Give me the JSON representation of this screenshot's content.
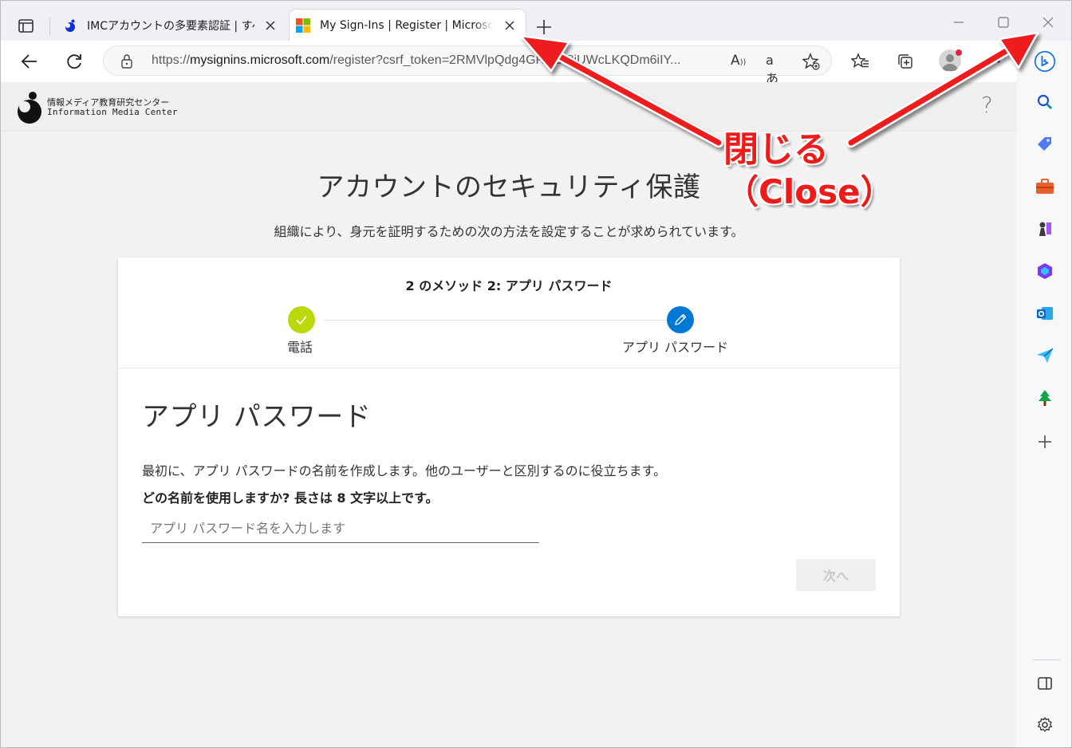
{
  "browser": {
    "tabs": [
      {
        "title": "IMCアカウントの多要素認証 | すべて",
        "active": false
      },
      {
        "title": "My Sign-Ins | Register | Microsoft",
        "active": true
      }
    ],
    "url_prefix": "https://",
    "url_host": "mysignins.microsoft.com",
    "url_rest": "/register?csrf_token=2RMVlpQdg4GRBOI8jUWcLKQDm6iIY...",
    "read_aloud_label": "A",
    "translate_label": "aあ"
  },
  "org": {
    "name_ja": "情報メディア教育研究センター",
    "name_en": "Information Media Center",
    "help_label": "?"
  },
  "page": {
    "title": "アカウントのセキュリティ保護",
    "subtitle": "組織により、身元を証明するための次の方法を設定することが求められています。"
  },
  "wizard": {
    "step_title": "2 のメソッド 2: アプリ パスワード",
    "steps": [
      {
        "label": "電話",
        "status": "done"
      },
      {
        "label": "アプリ パスワード",
        "status": "current"
      }
    ],
    "section_title": "アプリ パスワード",
    "description": "最初に、アプリ パスワードの名前を作成します。他のユーザーと区別するのに役立ちます。",
    "question": "どの名前を使用しますか? 長さは 8 文字以上です。",
    "input_placeholder": "アプリ パスワード名を入力します",
    "input_value": "",
    "next_label": "次へ",
    "next_enabled": false
  },
  "annotation": {
    "label_ja": "閉じる",
    "label_en": "（Close）",
    "color": "#ee1b1b"
  },
  "colors": {
    "step_done": "#bad80a",
    "step_current": "#0078d4",
    "accent": "#0078d4"
  }
}
